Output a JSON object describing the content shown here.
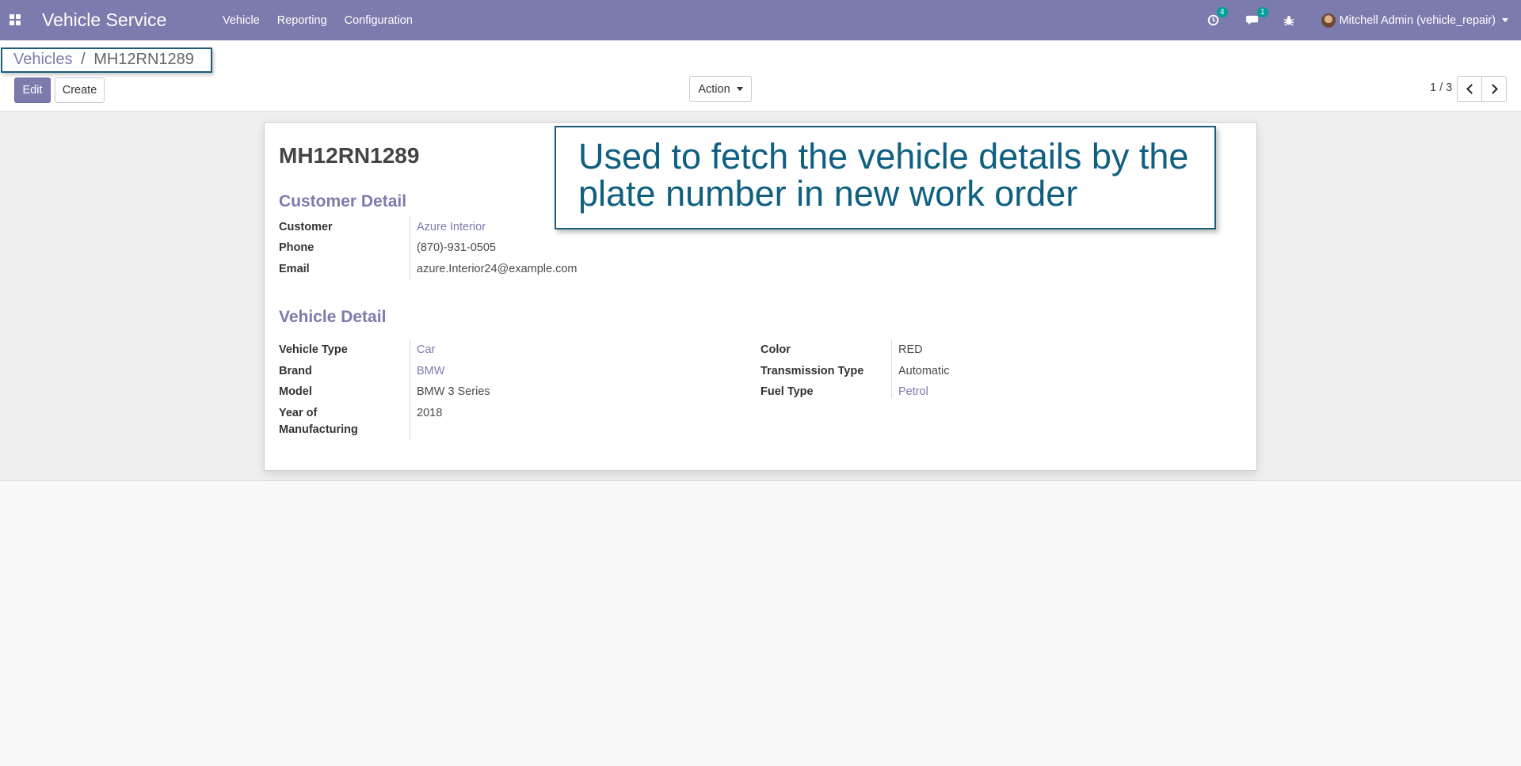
{
  "navbar": {
    "brand": "Vehicle Service",
    "menu": [
      "Vehicle",
      "Reporting",
      "Configuration"
    ],
    "activity_badge": "4",
    "messages_badge": "1",
    "user": "Mitchell Admin (vehicle_repair)"
  },
  "breadcrumb": {
    "parent": "Vehicles",
    "separator": "/",
    "current": "MH12RN1289"
  },
  "buttons": {
    "edit": "Edit",
    "create": "Create",
    "action": "Action"
  },
  "pager": {
    "value": "1 / 3"
  },
  "record": {
    "title": "MH12RN1289",
    "customer_section": "Customer Detail",
    "vehicle_section": "Vehicle Detail",
    "customer_fields": [
      {
        "label": "Customer",
        "value": "Azure Interior"
      },
      {
        "label": "Phone",
        "value": "(870)-931-0505"
      },
      {
        "label": "Email",
        "value": "azure.Interior24@example.com"
      }
    ],
    "vehicle_left": [
      {
        "label": "Vehicle Type",
        "value": "Car"
      },
      {
        "label": "Brand",
        "value": "BMW"
      },
      {
        "label": "Model",
        "value": "BMW 3 Series"
      },
      {
        "label": "Year of Manufacturing",
        "value": "2018"
      }
    ],
    "vehicle_right": [
      {
        "label": "Color",
        "value": "RED"
      },
      {
        "label": "Transmission Type",
        "value": "Automatic"
      },
      {
        "label": "Fuel Type",
        "value": "Petrol"
      }
    ]
  },
  "annotation": "Used to fetch the vehicle details by the plate number in new work order",
  "colors": {
    "navbar": "#7c7bad",
    "accent": "#7c7bad",
    "badge": "#00a09d",
    "annotation_border": "#1b5d7a",
    "annotation_text": "#0f6080"
  },
  "icons": {
    "apps": "apps-grid-icon",
    "activity": "clock-icon",
    "messages": "chat-icon",
    "debug": "bug-icon"
  }
}
